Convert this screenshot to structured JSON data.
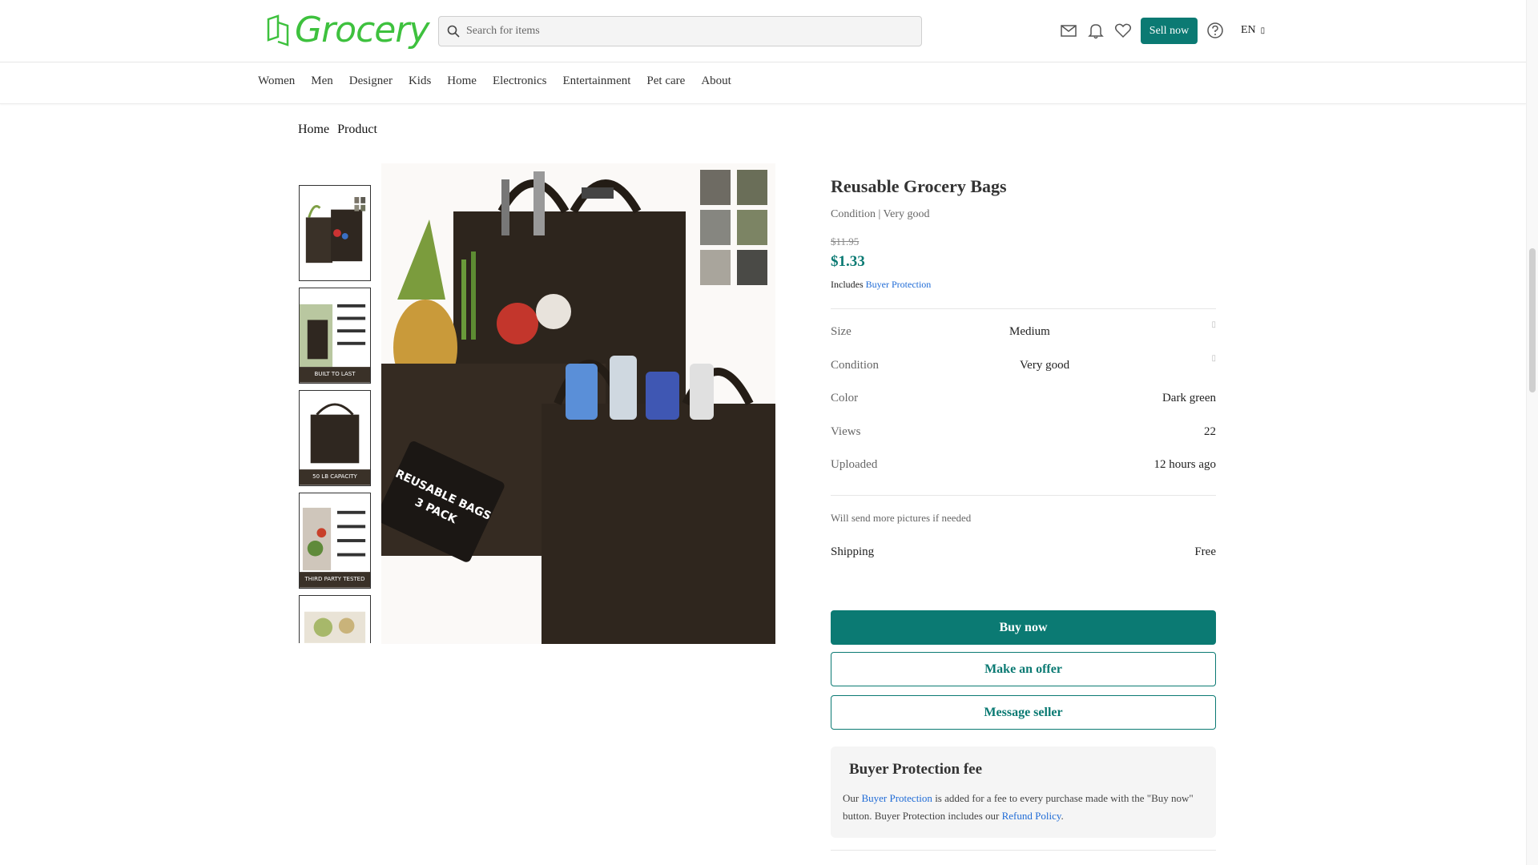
{
  "header": {
    "logo_text": "Grocery",
    "search_placeholder": "Search for items",
    "sell_label": "Sell now",
    "lang": "EN",
    "icons": [
      "mail-icon",
      "bell-icon",
      "heart-icon",
      "help-icon"
    ]
  },
  "nav": {
    "categories": [
      "Women",
      "Men",
      "Designer",
      "Kids",
      "Home",
      "Electronics",
      "Entertainment",
      "Pet care",
      "About"
    ]
  },
  "breadcrumb": {
    "home": "Home",
    "separator": "",
    "current": "Product"
  },
  "thumbnails": {
    "up_glyph": "",
    "down_glyph": "",
    "captions": [
      "",
      "BUILT TO LAST",
      "50 LB CAPACITY",
      "THIRD PARTY TESTED",
      ""
    ]
  },
  "image": {
    "tag_text": "REUSABLE BAGS 3 PACK"
  },
  "product": {
    "title": "Reusable Grocery Bags",
    "condition_line": "Condition | Very good",
    "old_price": "$11.95",
    "price": "$1.33",
    "includes": "Includes",
    "buyer_protection_link": "Buyer Protection",
    "info_glyph": "",
    "attributes": [
      {
        "key": "Size",
        "value": "Medium"
      },
      {
        "key": "Condition",
        "value": "Very good"
      },
      {
        "key": "Color",
        "value": "Dark green"
      },
      {
        "key": "Views",
        "value": "22"
      },
      {
        "key": "Uploaded",
        "value": "12 hours ago"
      }
    ],
    "description": "Will send more pictures if needed",
    "shipping_label": "Shipping",
    "shipping_value": "Free"
  },
  "actions": {
    "buy_now": "Buy now",
    "make_offer": "Make an offer",
    "message_seller": "Message seller"
  },
  "buyer_protection": {
    "shield_glyph": "",
    "title": "Buyer Protection fee",
    "text_pre": "Our",
    "link1": "Buyer Protection",
    "text_mid": "is added for a fee to every purchase made with the \"Buy now\" button. Buyer Protection includes our",
    "link2": "Refund Policy",
    "text_end": "."
  },
  "colors": {
    "brand": "#0b7a73",
    "logo": "#3ec13e",
    "link": "#1f6bd6"
  }
}
